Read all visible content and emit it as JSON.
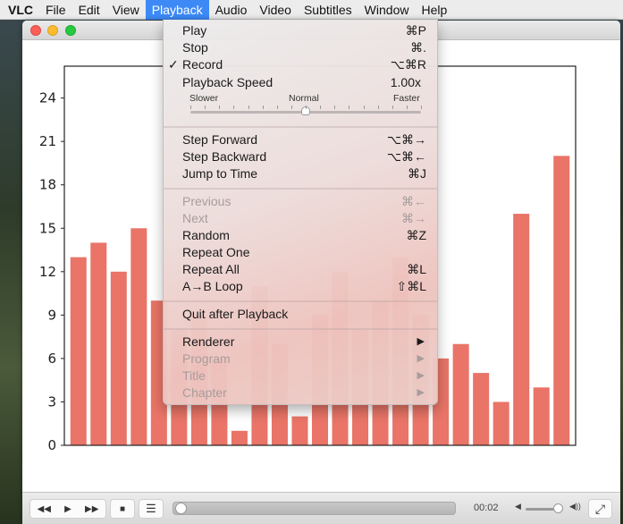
{
  "menubar": {
    "app": "VLC",
    "items": [
      "File",
      "Edit",
      "View",
      "Playback",
      "Audio",
      "Video",
      "Subtitles",
      "Window",
      "Help"
    ],
    "active": "Playback"
  },
  "playback_menu": {
    "play": {
      "label": "Play",
      "shortcut": "⌘P"
    },
    "stop": {
      "label": "Stop",
      "shortcut": "⌘."
    },
    "record": {
      "label": "Record",
      "shortcut": "⌥⌘R",
      "checked": true,
      "check": "✓"
    },
    "speed": {
      "label": "Playback Speed",
      "value": "1.00x",
      "slower": "Slower",
      "normal": "Normal",
      "faster": "Faster",
      "level": 0.5
    },
    "step_forward": {
      "label": "Step Forward",
      "shortcut": "⌥⌘→"
    },
    "step_backward": {
      "label": "Step Backward",
      "shortcut": "⌥⌘←"
    },
    "jump": {
      "label": "Jump to Time",
      "shortcut": "⌘J"
    },
    "previous": {
      "label": "Previous",
      "shortcut": "⌘←",
      "disabled": true
    },
    "next": {
      "label": "Next",
      "shortcut": "⌘→",
      "disabled": true
    },
    "random": {
      "label": "Random",
      "shortcut": "⌘Z"
    },
    "repeat_one": {
      "label": "Repeat One"
    },
    "repeat_all": {
      "label": "Repeat All",
      "shortcut": "⌘L"
    },
    "ab_loop": {
      "label": "A→B Loop",
      "shortcut": "⇧⌘L"
    },
    "quit_after": {
      "label": "Quit after Playback"
    },
    "renderer": {
      "label": "Renderer"
    },
    "program": {
      "label": "Program",
      "disabled": true
    },
    "title": {
      "label": "Title",
      "disabled": true
    },
    "chapter": {
      "label": "Chapter",
      "disabled": true
    },
    "submenu_arrow": "▶"
  },
  "controls": {
    "rewind": "◀◀",
    "play": "▶",
    "forward": "▶▶",
    "stop": "■",
    "playlist": "☰",
    "time": "00:02",
    "progress": 0.0,
    "volume": 0.85,
    "fullscreen": "⤢",
    "vol_low": "🔈",
    "vol_high": "🔊"
  },
  "chart_data": {
    "type": "bar",
    "color": "#e97467",
    "ylim": [
      0,
      26.2
    ],
    "yticks": [
      "0",
      "3",
      "6",
      "9",
      "12",
      "15",
      "18",
      "21",
      "24"
    ],
    "values": [
      13,
      14,
      12,
      15,
      10,
      8,
      9,
      6,
      1,
      11,
      7,
      2,
      9,
      12,
      8,
      10,
      13,
      9,
      6,
      7,
      5,
      3,
      16,
      4,
      20
    ]
  }
}
